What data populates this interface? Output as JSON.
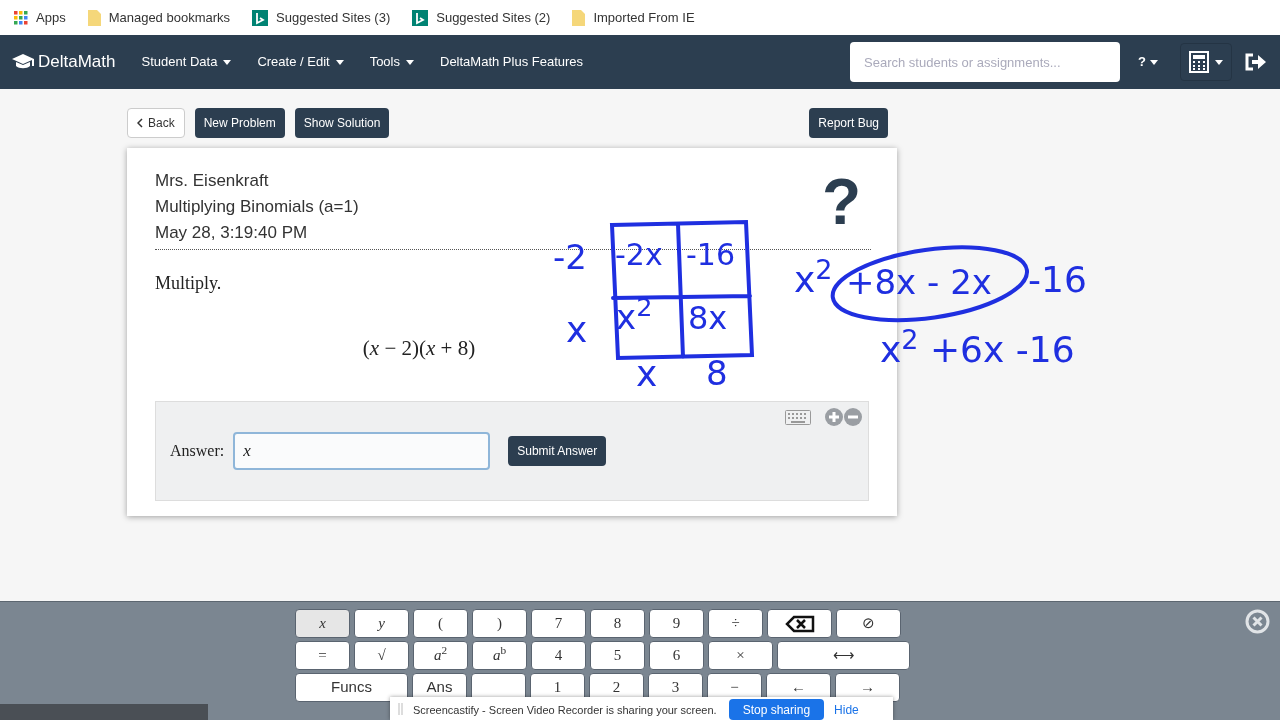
{
  "bookmarks": [
    {
      "label": "Apps",
      "kind": "apps"
    },
    {
      "label": "Managed bookmarks",
      "kind": "folder"
    },
    {
      "label": "Suggested Sites (3)",
      "kind": "bing"
    },
    {
      "label": "Suggested Sites (2)",
      "kind": "bing"
    },
    {
      "label": "Imported From IE",
      "kind": "folder"
    }
  ],
  "navbar": {
    "brand": "DeltaMath",
    "menus": [
      {
        "label": "Student Data",
        "dropdown": true
      },
      {
        "label": "Create / Edit",
        "dropdown": true
      },
      {
        "label": "Tools",
        "dropdown": true
      },
      {
        "label": "DeltaMath Plus Features",
        "dropdown": false
      }
    ],
    "search": {
      "placeholder": "Search students or assignments..."
    },
    "help": "?"
  },
  "toolbar": {
    "back": "Back",
    "buttons": [
      "New Problem",
      "Show Solution"
    ],
    "report": "Report Bug"
  },
  "problem": {
    "teacher": "Mrs. Eisenkraft",
    "skill": "Multiplying Binomials (a=1)",
    "timestamp": "May 28, 3:19:40 PM",
    "help_mark": "?",
    "instruction": "Multiply.",
    "expression": "(*x* − 2)(*x* + 8)"
  },
  "answer": {
    "label": "Answer:",
    "value": "x",
    "submit": "Submit Answer"
  },
  "handwriting": [
    "-2",
    "-2x",
    "-16",
    "x",
    "x$^{2}$",
    "8x",
    "x",
    "8",
    "x$^{2}$",
    "+8x - 2x",
    "-16",
    "x$^{2}$ +6x -16"
  ],
  "keypad": [
    [
      {
        "label": "*x*",
        "selected": true
      },
      {
        "label": "*y*",
        "selected": false
      },
      {
        "label": "(",
        "selected": false
      },
      {
        "label": ")",
        "selected": false
      },
      {
        "label": "7",
        "selected": false
      },
      {
        "label": "8",
        "selected": false
      },
      {
        "label": "9",
        "selected": false
      },
      {
        "label": "÷",
        "selected": false
      },
      {
        "kind": "backspace",
        "selected": false
      },
      {
        "label": "⊘",
        "selected": false
      }
    ],
    [
      {
        "label": "=",
        "selected": false
      },
      {
        "label": "√",
        "selected": false
      },
      {
        "label": "*a*$^{2}$",
        "selected": false
      },
      {
        "label": "*a*$^{b}$",
        "selected": false
      },
      {
        "label": "4",
        "selected": false
      },
      {
        "label": "5",
        "selected": false
      },
      {
        "label": "6",
        "selected": false
      },
      {
        "label": "×",
        "selected": false
      },
      {
        "label": "⟷",
        "selected": false,
        "kind": "wide"
      }
    ],
    [
      {
        "label": "Funcs",
        "selected": false,
        "kind": "wide"
      },
      {
        "label": "Ans",
        "selected": false
      },
      {
        "kind": "blank",
        "selected": false
      },
      {
        "label": "1",
        "selected": false
      },
      {
        "label": "2",
        "selected": false
      },
      {
        "label": "3",
        "selected": false
      },
      {
        "label": "−",
        "selected": false
      },
      {
        "label": "←",
        "selected": false
      },
      {
        "label": "→",
        "selected": false
      }
    ]
  ],
  "share_bar": {
    "message": "Screencastify - Screen Video Recorder is sharing your screen.",
    "stop": "Stop sharing",
    "hide": "Hide"
  }
}
